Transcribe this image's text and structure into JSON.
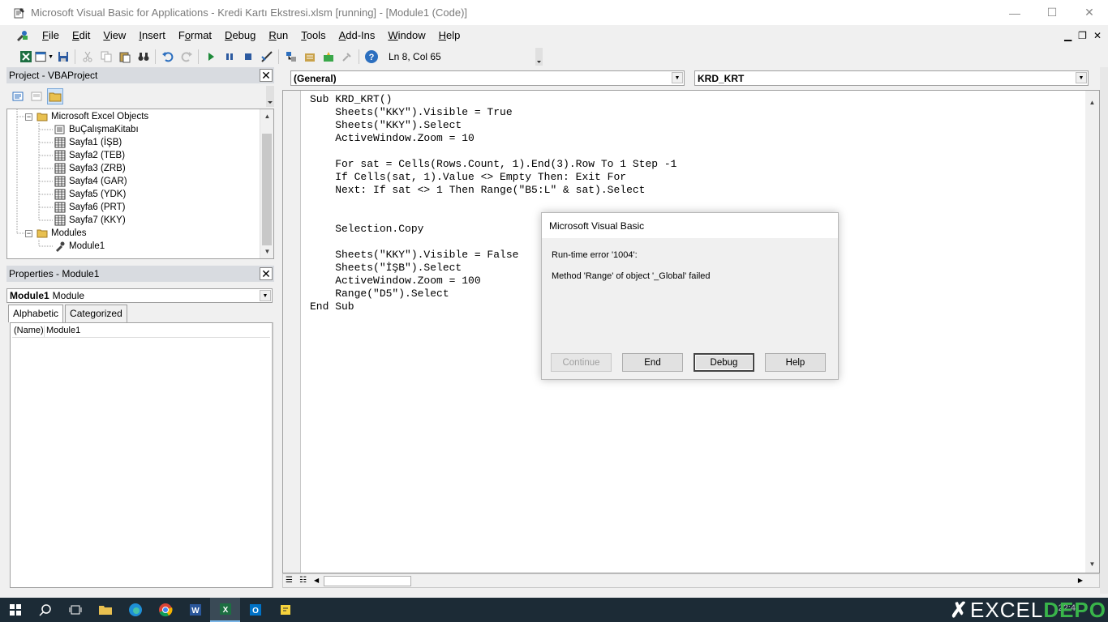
{
  "window": {
    "title": "Microsoft Visual Basic for Applications - Kredi Kartı Ekstresi.xlsm [running] - [Module1 (Code)]",
    "minimize": "—",
    "maximize": "☐",
    "close": "✕"
  },
  "menu": {
    "items": [
      {
        "label": "File",
        "key": "F",
        "rest": "ile"
      },
      {
        "label": "Edit",
        "key": "E",
        "rest": "dit"
      },
      {
        "label": "View",
        "key": "V",
        "rest": "iew"
      },
      {
        "label": "Insert",
        "key": "I",
        "rest": "nsert"
      },
      {
        "label": "Format",
        "key": "o",
        "pre": "F",
        "rest": "rmat"
      },
      {
        "label": "Debug",
        "key": "D",
        "rest": "ebug"
      },
      {
        "label": "Run",
        "key": "R",
        "rest": "un"
      },
      {
        "label": "Tools",
        "key": "T",
        "rest": "ools"
      },
      {
        "label": "Add-Ins",
        "key": "A",
        "rest": "dd-Ins"
      },
      {
        "label": "Window",
        "key": "W",
        "rest": "indow"
      },
      {
        "label": "Help",
        "key": "H",
        "rest": "elp"
      }
    ],
    "mdi_minimize": "▁",
    "mdi_restore": "❐",
    "mdi_close": "✕"
  },
  "toolbar": {
    "status": "Ln 8, Col 65"
  },
  "project": {
    "title": "Project - VBAProject",
    "close": "✕",
    "tree": [
      {
        "label": "Microsoft Excel Objects",
        "level": 1,
        "type": "folder",
        "expander": "−"
      },
      {
        "label": "BuÇalışmaKitabı",
        "level": 2,
        "type": "workbook"
      },
      {
        "label": "Sayfa1 (İŞB)",
        "level": 2,
        "type": "sheet"
      },
      {
        "label": "Sayfa2 (TEB)",
        "level": 2,
        "type": "sheet"
      },
      {
        "label": "Sayfa3 (ZRB)",
        "level": 2,
        "type": "sheet"
      },
      {
        "label": "Sayfa4 (GAR)",
        "level": 2,
        "type": "sheet"
      },
      {
        "label": "Sayfa5 (YDK)",
        "level": 2,
        "type": "sheet"
      },
      {
        "label": "Sayfa6 (PRT)",
        "level": 2,
        "type": "sheet"
      },
      {
        "label": "Sayfa7 (KKY)",
        "level": 2,
        "type": "sheet"
      },
      {
        "label": "Modules",
        "level": 1,
        "type": "folder",
        "expander": "−"
      },
      {
        "label": "Module1",
        "level": 2,
        "type": "module"
      }
    ]
  },
  "properties": {
    "title": "Properties - Module1",
    "close": "✕",
    "object_name": "Module1",
    "object_type": "Module",
    "tabs": [
      "Alphabetic",
      "Categorized"
    ],
    "rows": [
      {
        "name": "(Name)",
        "value": "Module1"
      }
    ]
  },
  "code": {
    "object_combo": "(General)",
    "proc_combo": "KRD_KRT",
    "lines": [
      "Sub KRD_KRT()",
      "    Sheets(\"KKY\").Visible = True",
      "    Sheets(\"KKY\").Select",
      "    ActiveWindow.Zoom = 10",
      "",
      "    For sat = Cells(Rows.Count, 1).End(3).Row To 1 Step -1",
      "    If Cells(sat, 1).Value <> Empty Then: Exit For",
      "    Next: If sat <> 1 Then Range(\"B5:L\" & sat).Select",
      "",
      "",
      "    Selection.Copy",
      "",
      "    Sheets(\"KKY\").Visible = False",
      "    Sheets(\"İŞB\").Select",
      "    ActiveWindow.Zoom = 100",
      "    Range(\"D5\").Select",
      "End Sub"
    ]
  },
  "dialog": {
    "title": "Microsoft Visual Basic",
    "error_line": "Run-time error '1004':",
    "message": "Method 'Range' of object '_Global' failed",
    "buttons": {
      "continue": "Continue",
      "end": "End",
      "debug": "Debug",
      "help": "Help"
    }
  },
  "taskbar": {
    "clock": "22:4",
    "watermark_excel": "EXCEL",
    "watermark_depo": "DEPO"
  },
  "colors": {
    "excel_green": "#1d6f42",
    "taskbar_bg": "#1c2b36",
    "depo_green": "#39b54a"
  }
}
